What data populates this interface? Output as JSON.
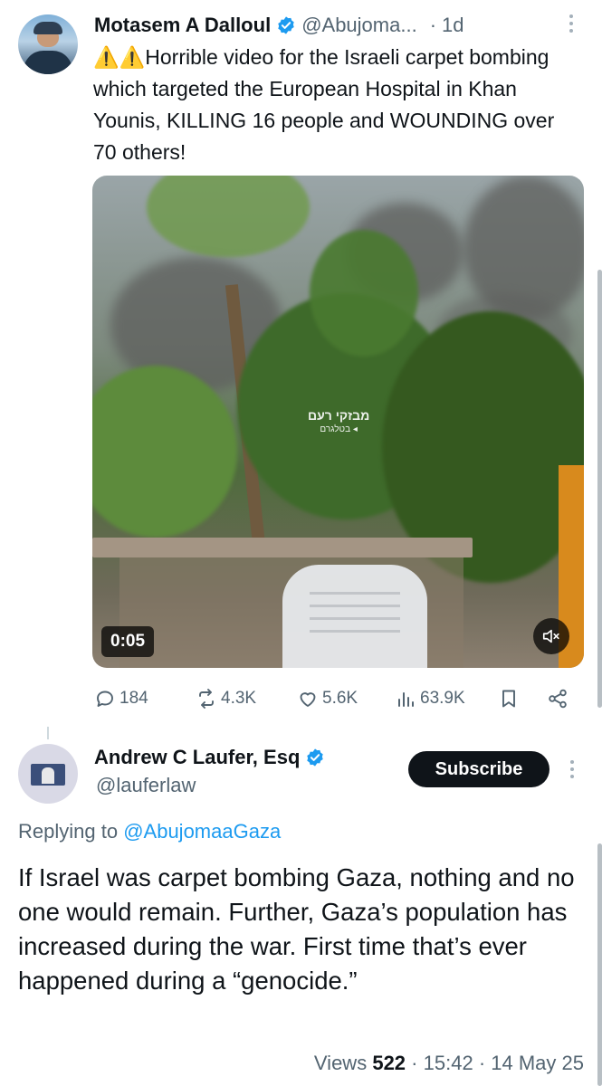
{
  "tweet": {
    "author_name": "Motasem A Dalloul",
    "handle": "@Abujoma...",
    "time_sep": "·",
    "time": "1d",
    "text_prefix": "⚠️⚠️",
    "text": "Horrible video for the Israeli carpet bombing which targeted the European Hospital in Khan Younis, KILLING 16 people and WOUNDING over 70 others!",
    "video": {
      "duration": "0:05",
      "watermark_line1": "מבזקי רעם",
      "watermark_line2": "בטלגרם ◂"
    },
    "stats": {
      "replies": "184",
      "reposts": "4.3K",
      "likes": "5.6K",
      "views": "63.9K"
    }
  },
  "reply": {
    "author_name": "Andrew C Laufer, Esq",
    "handle": "@lauferlaw",
    "subscribe_label": "Subscribe",
    "replying_to_label": "Replying to",
    "replying_to_handle": "@AbujomaaGaza",
    "text": "If Israel was carpet bombing Gaza, nothing and no one would remain.  Further,  Gaza’s population has increased during the war. First time that’s ever happened during a “genocide.”",
    "views_label": "Views",
    "views_count": "522",
    "sep": "·",
    "time": "15:42",
    "date": "14 May 25"
  },
  "colors": {
    "accent": "#1d9bf0",
    "text": "#0f1419",
    "muted": "#536471",
    "subscribe_bg": "#0f1419"
  }
}
